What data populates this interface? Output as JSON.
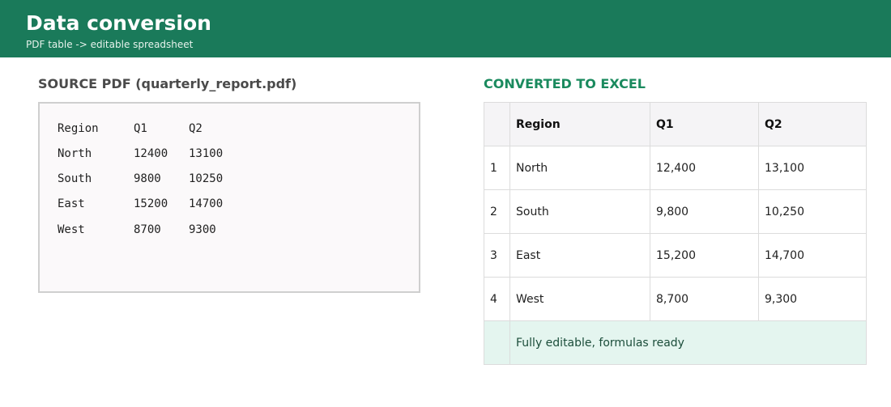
{
  "header": {
    "title": "Data conversion",
    "subtitle": "PDF table -> editable spreadsheet"
  },
  "pdf": {
    "title": "SOURCE PDF (quarterly_report.pdf)",
    "rows": [
      [
        "Region",
        "Q1",
        "Q2"
      ],
      [
        "North",
        "12400",
        "13100"
      ],
      [
        "South",
        "9800",
        "10250"
      ],
      [
        "East",
        "15200",
        "14700"
      ],
      [
        "West",
        "8700",
        "9300"
      ]
    ]
  },
  "excel": {
    "title": "CONVERTED TO EXCEL",
    "headers": [
      "",
      "Region",
      "Q1",
      "Q2"
    ],
    "rows": [
      [
        "1",
        "North",
        "12,400",
        "13,100"
      ],
      [
        "2",
        "South",
        "9,800",
        "10,250"
      ],
      [
        "3",
        "East",
        "15,200",
        "14,700"
      ],
      [
        "4",
        "West",
        "8,700",
        "9,300"
      ]
    ],
    "footer_note": "Fully editable, formulas ready"
  },
  "colors": {
    "header_bg": "#1a7a5a",
    "accent": "#1a8a5e",
    "footer_bg": "#e4f5ef"
  }
}
